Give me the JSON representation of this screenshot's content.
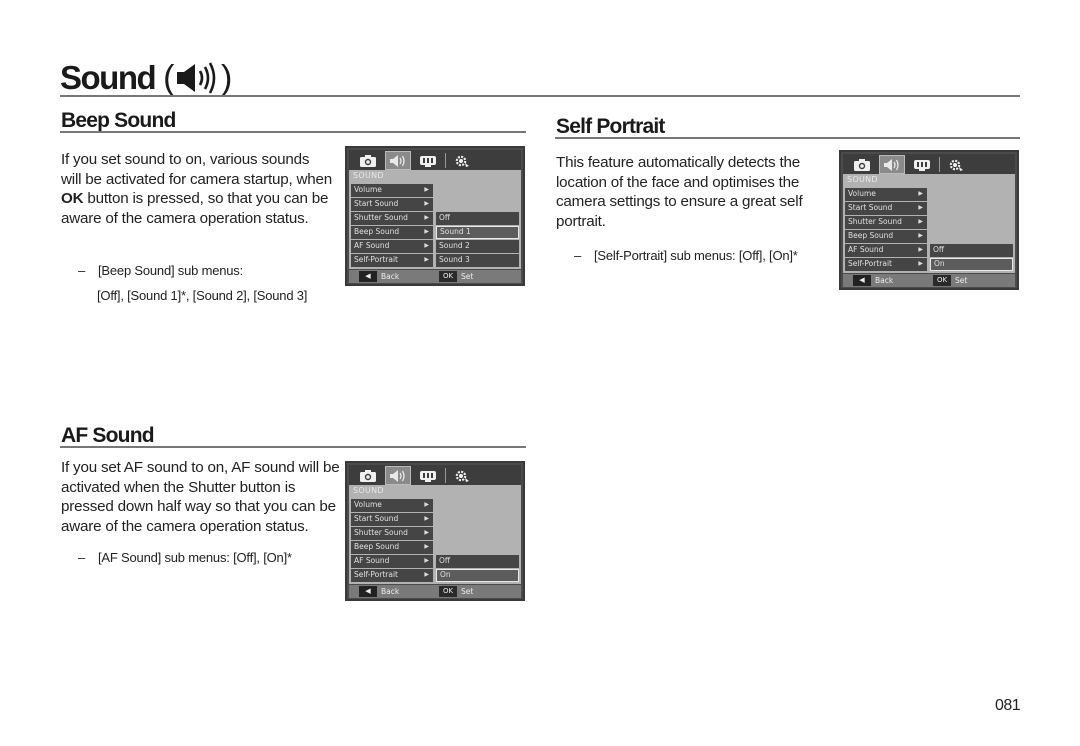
{
  "page": {
    "title": "Sound",
    "title_icon": "speaker-sound-icon",
    "page_number": "081"
  },
  "sections": {
    "beep": {
      "heading": "Beep Sound",
      "body_pre": "If you set sound to on, various sounds will be activated for camera startup, when ",
      "body_bold": "OK",
      "body_post": " button is pressed, so that you can be aware of the camera operation status.",
      "note_dash": "–",
      "note_line1": "[Beep Sound] sub menus:",
      "note_line2": "[Off], [Sound 1]*, [Sound 2], [Sound 3]"
    },
    "self_portrait": {
      "heading": "Self Portrait",
      "body": "This feature automatically detects the location of the face and optimises the camera settings to ensure a great self portrait.",
      "note_dash": "–",
      "note_line1": "[Self-Portrait] sub menus: [Off], [On]*"
    },
    "af": {
      "heading": "AF Sound",
      "body": "If you set AF sound to on, AF sound will be activated when the Shutter button is pressed down half way so that you can be aware of the camera operation status.",
      "note_dash": "–",
      "note_line1": "[AF Sound] sub menus: [Off], [On]*"
    }
  },
  "camera_menu": {
    "tabs": [
      "camera-icon",
      "sound-icon",
      "display-icon",
      "settings-icon"
    ],
    "active_tab": "sound-icon",
    "label": "SOUND",
    "items": [
      "Volume",
      "Start Sound",
      "Shutter Sound",
      "Beep Sound",
      "AF Sound",
      "Self-Portrait"
    ],
    "arrow": "▶",
    "footer": {
      "back_icon": "◀",
      "back_label": "Back",
      "ok_label": "OK",
      "set_label": "Set"
    }
  },
  "screens": {
    "beep": {
      "options": [
        "Off",
        "Sound 1",
        "Sound 2",
        "Sound 3"
      ],
      "selected": "Sound 1"
    },
    "self_portrait": {
      "options": [
        "Off",
        "On"
      ],
      "selected": "On"
    },
    "af": {
      "options": [
        "Off",
        "On"
      ],
      "selected": "On"
    }
  }
}
